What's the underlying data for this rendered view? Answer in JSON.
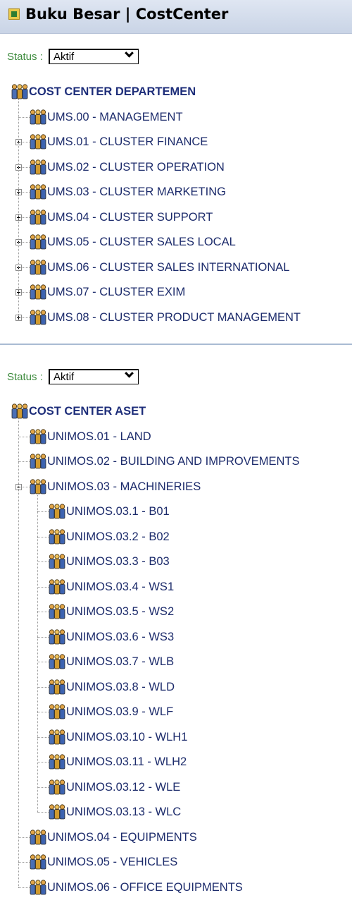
{
  "header": {
    "title": "Buku Besar | CostCenter"
  },
  "panels": [
    {
      "status": {
        "label": "Status :",
        "value": "Aktif"
      },
      "root": "COST CENTER DEPARTEMEN",
      "items": [
        {
          "label": "UMS.00 - MANAGEMENT",
          "toggle": "none"
        },
        {
          "label": "UMS.01 - CLUSTER FINANCE",
          "toggle": "plus"
        },
        {
          "label": "UMS.02 - CLUSTER OPERATION",
          "toggle": "plus"
        },
        {
          "label": "UMS.03 - CLUSTER MARKETING",
          "toggle": "plus"
        },
        {
          "label": "UMS.04 - CLUSTER SUPPORT",
          "toggle": "plus"
        },
        {
          "label": "UMS.05 - CLUSTER SALES LOCAL",
          "toggle": "plus"
        },
        {
          "label": "UMS.06 - CLUSTER SALES INTERNATIONAL",
          "toggle": "plus"
        },
        {
          "label": "UMS.07 - CLUSTER EXIM",
          "toggle": "plus"
        },
        {
          "label": "UMS.08 - CLUSTER PRODUCT MANAGEMENT",
          "toggle": "plus"
        }
      ]
    },
    {
      "status": {
        "label": "Status :",
        "value": "Aktif"
      },
      "root": "COST CENTER ASET",
      "items": [
        {
          "label": "UNIMOS.01 - LAND",
          "toggle": "none"
        },
        {
          "label": "UNIMOS.02 - BUILDING AND IMPROVEMENTS",
          "toggle": "none"
        },
        {
          "label": "UNIMOS.03 - MACHINERIES",
          "toggle": "minus",
          "children": [
            "UNIMOS.03.1 - B01",
            "UNIMOS.03.2 - B02",
            "UNIMOS.03.3 - B03",
            "UNIMOS.03.4 - WS1",
            "UNIMOS.03.5 - WS2",
            "UNIMOS.03.6 - WS3",
            "UNIMOS.03.7 - WLB",
            "UNIMOS.03.8 - WLD",
            "UNIMOS.03.9 - WLF",
            "UNIMOS.03.10 - WLH1",
            "UNIMOS.03.11 - WLH2",
            "UNIMOS.03.12 - WLE",
            "UNIMOS.03.13 - WLC"
          ]
        },
        {
          "label": "UNIMOS.04 - EQUIPMENTS",
          "toggle": "none"
        },
        {
          "label": "UNIMOS.05 - VEHICLES",
          "toggle": "none"
        },
        {
          "label": "UNIMOS.06 - OFFICE EQUIPMENTS",
          "toggle": "none"
        }
      ]
    }
  ],
  "icons": {
    "header": "ledger-icon",
    "node": "people-group-icon"
  },
  "colors": {
    "link": "#1c2b6b",
    "status": "#3d8b3d",
    "header_bg": "#c9d4e6"
  }
}
